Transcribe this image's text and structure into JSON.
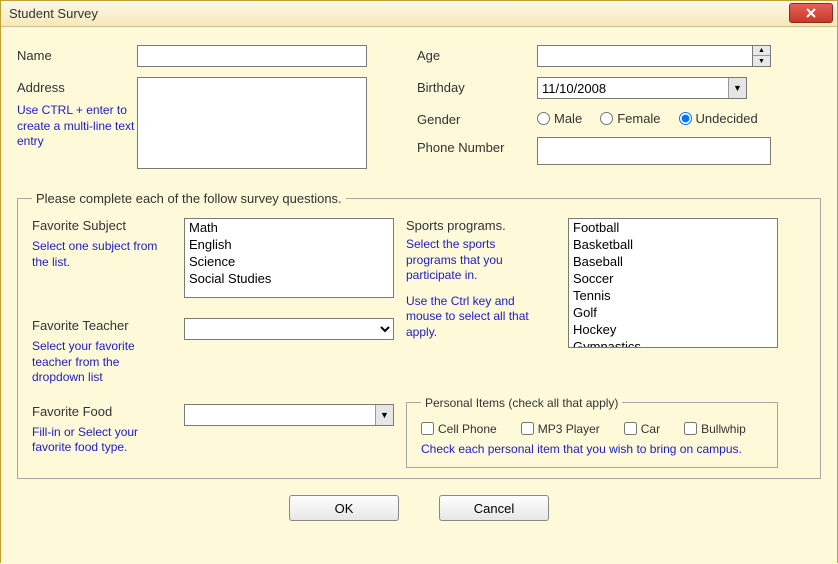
{
  "window": {
    "title": "Student Survey"
  },
  "fields": {
    "name": {
      "label": "Name",
      "value": ""
    },
    "address": {
      "label": "Address",
      "hint": "Use CTRL + enter to create a multi-line text entry",
      "value": ""
    },
    "age": {
      "label": "Age",
      "value": ""
    },
    "birthday": {
      "label": "Birthday",
      "value": "11/10/2008"
    },
    "gender": {
      "label": "Gender",
      "options": [
        {
          "value": "male",
          "label": "Male",
          "checked": false
        },
        {
          "value": "female",
          "label": "Female",
          "checked": false
        },
        {
          "value": "undecided",
          "label": "Undecided",
          "checked": true
        }
      ]
    },
    "phone": {
      "label": "Phone Number",
      "value": ""
    }
  },
  "survey": {
    "legend": "Please complete each of the follow survey questions.",
    "favorite_subject": {
      "label": "Favorite Subject",
      "hint": "Select one subject from the list.",
      "items": [
        "Math",
        "English",
        "Science",
        "Social Studies"
      ]
    },
    "favorite_teacher": {
      "label": "Favorite Teacher",
      "hint": "Select your favorite teacher from the dropdown list",
      "value": ""
    },
    "favorite_food": {
      "label": "Favorite Food",
      "hint": "Fill-in or Select your favorite food type.",
      "value": ""
    },
    "sports": {
      "label": "Sports programs.",
      "hint1": "Select the sports programs that you participate in.",
      "hint2": "Use the Ctrl key and mouse to select all that apply.",
      "items": [
        "Football",
        "Basketball",
        "Baseball",
        "Soccer",
        "Tennis",
        "Golf",
        "Hockey",
        "Gymnastics"
      ]
    },
    "personal": {
      "legend": "Personal Items (check all that apply)",
      "items": [
        {
          "label": "Cell Phone"
        },
        {
          "label": "MP3 Player"
        },
        {
          "label": "Car"
        },
        {
          "label": "Bullwhip"
        }
      ],
      "hint": "Check each personal item that you wish to bring on campus."
    }
  },
  "buttons": {
    "ok": "OK",
    "cancel": "Cancel"
  }
}
